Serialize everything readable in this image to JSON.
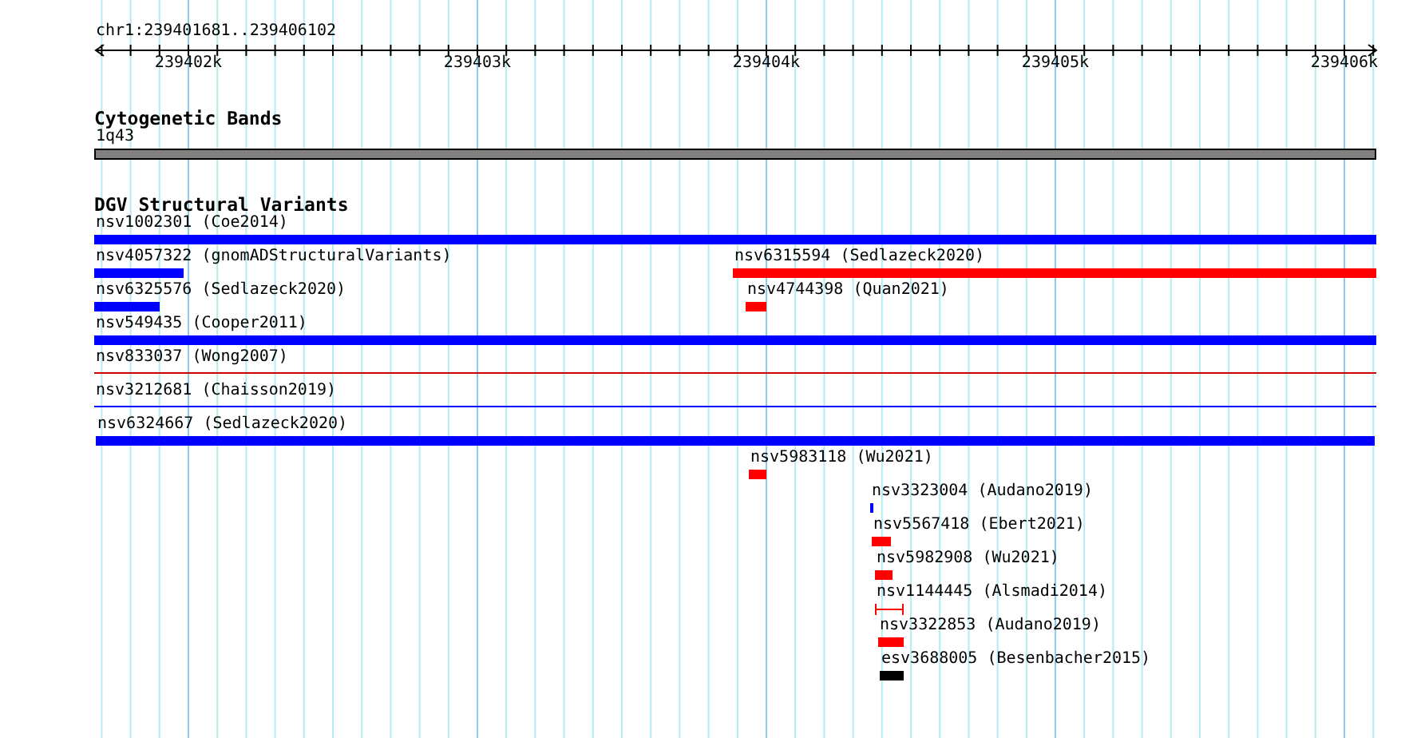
{
  "ruler": {
    "location": "chr1:239401681..239406102",
    "ticks": [
      "239402k",
      "239403k",
      "239404k",
      "239405k",
      "239406k"
    ]
  },
  "cytogenetic_bands": {
    "title": "Cytogenetic Bands",
    "band": "1q43"
  },
  "dgv_track": {
    "title": "DGV Structural Variants",
    "rows": [
      {
        "features": [
          {
            "label": "nsv1002301 (Coe2014)",
            "kind": "bar",
            "color": "#0000ff"
          }
        ]
      },
      {
        "features": [
          {
            "label": "nsv4057322 (gnomADStructuralVariants)",
            "kind": "bar",
            "color": "#0000ff"
          },
          {
            "label": "nsv6315594 (Sedlazeck2020)",
            "kind": "bar",
            "color": "#ff0000"
          }
        ]
      },
      {
        "features": [
          {
            "label": "nsv6325576 (Sedlazeck2020)",
            "kind": "bar",
            "color": "#0000ff"
          },
          {
            "label": "nsv4744398 (Quan2021)",
            "kind": "bar",
            "color": "#ff0000"
          }
        ]
      },
      {
        "features": [
          {
            "label": "nsv549435 (Cooper2011)",
            "kind": "bar",
            "color": "#0000ff"
          }
        ]
      },
      {
        "features": [
          {
            "label": "nsv833037 (Wong2007)",
            "kind": "line",
            "color": "#cc0000"
          }
        ]
      },
      {
        "features": [
          {
            "label": "nsv3212681 (Chaisson2019)",
            "kind": "line",
            "color": "#0000ff"
          }
        ]
      },
      {
        "features": [
          {
            "label": "nsv6324667 (Sedlazeck2020)",
            "kind": "bar",
            "color": "#0000ff"
          }
        ]
      },
      {
        "features": [
          {
            "label": "nsv5983118 (Wu2021)",
            "kind": "bar",
            "color": "#ff0000"
          }
        ]
      },
      {
        "features": [
          {
            "label": "nsv3323004 (Audano2019)",
            "kind": "bar",
            "color": "#0000ff"
          }
        ]
      },
      {
        "features": [
          {
            "label": "nsv5567418 (Ebert2021)",
            "kind": "bar",
            "color": "#ff0000"
          }
        ]
      },
      {
        "features": [
          {
            "label": "nsv5982908 (Wu2021)",
            "kind": "bar",
            "color": "#ff0000"
          }
        ]
      },
      {
        "features": [
          {
            "label": "nsv1144445 (Alsmadi2014)",
            "kind": "interval",
            "color": "#ff0000"
          }
        ]
      },
      {
        "features": [
          {
            "label": "nsv3322853 (Audano2019)",
            "kind": "bar",
            "color": "#ff0000"
          }
        ]
      },
      {
        "features": [
          {
            "label": "esv3688005 (Besenbacher2015)",
            "kind": "bar",
            "color": "#000000"
          }
        ]
      }
    ]
  }
}
